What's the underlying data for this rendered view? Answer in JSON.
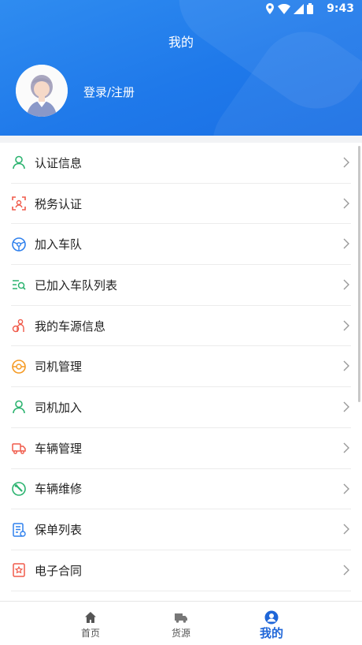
{
  "status_bar": {
    "time": "9:43"
  },
  "header": {
    "title": "我的",
    "login_label": "登录/注册"
  },
  "menu": {
    "items": [
      {
        "label": "认证信息",
        "icon": "person-outline-icon",
        "color": "#2bb36f"
      },
      {
        "label": "税务认证",
        "icon": "face-scan-icon",
        "color": "#f05a4a"
      },
      {
        "label": "加入车队",
        "icon": "steering-wheel-icon",
        "color": "#2f80ed"
      },
      {
        "label": "已加入车队列表",
        "icon": "list-search-icon",
        "color": "#2bb36f"
      },
      {
        "label": "我的车源信息",
        "icon": "driver-icon",
        "color": "#f05a4a"
      },
      {
        "label": "司机管理",
        "icon": "steering-wheel-icon",
        "color": "#f59a23"
      },
      {
        "label": "司机加入",
        "icon": "person-outline-icon",
        "color": "#2bb36f"
      },
      {
        "label": "车辆管理",
        "icon": "truck-icon",
        "color": "#f05a4a"
      },
      {
        "label": "车辆维修",
        "icon": "wrench-icon",
        "color": "#2bb36f"
      },
      {
        "label": "保单列表",
        "icon": "policy-document-icon",
        "color": "#2f80ed"
      },
      {
        "label": "电子合同",
        "icon": "contract-icon",
        "color": "#f05a4a"
      }
    ]
  },
  "tabbar": {
    "tabs": [
      {
        "label": "首页",
        "icon": "home-icon"
      },
      {
        "label": "货源",
        "icon": "truck-icon"
      },
      {
        "label": "我的",
        "icon": "user-circle-icon",
        "active": true
      }
    ]
  },
  "colors": {
    "header": "#1f79ea",
    "accent": "#1f66d8"
  }
}
